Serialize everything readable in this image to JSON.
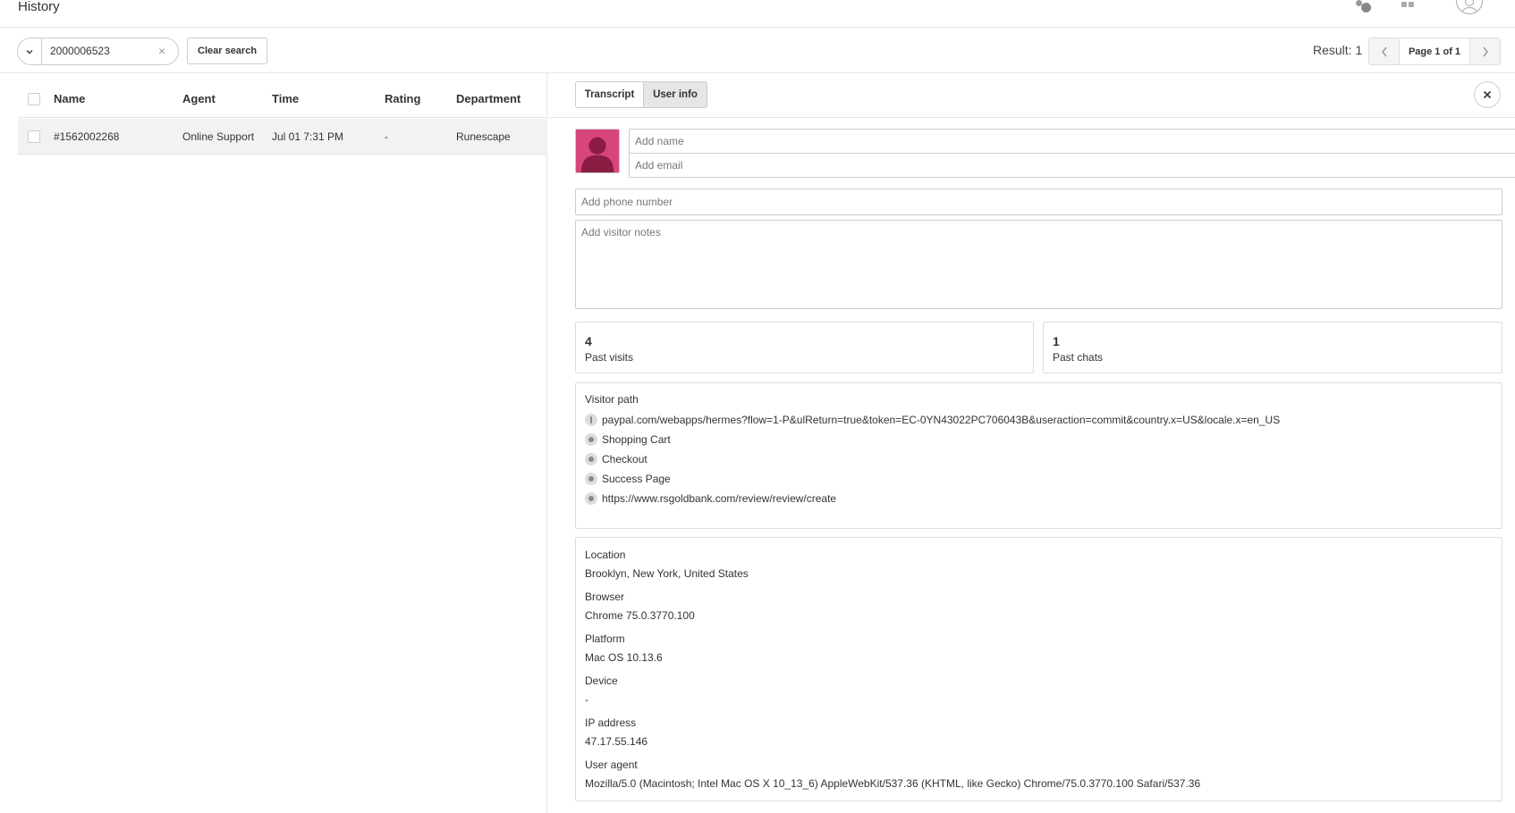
{
  "header": {
    "title": "History",
    "icons": [
      "status-dots-icon",
      "apps-grid-icon",
      "user-avatar-icon"
    ]
  },
  "search": {
    "value": "2000006523",
    "clear_label": "Clear search"
  },
  "results": {
    "count_label": "Result: 1",
    "page_label": "Page 1 of 1"
  },
  "table": {
    "columns": [
      "Name",
      "Agent",
      "Time",
      "Rating",
      "Department"
    ],
    "rows": [
      {
        "name": "#1562002268",
        "agent": "Online Support",
        "time": "Jul 01 7:31 PM",
        "rating": "-",
        "department": "Runescape"
      }
    ]
  },
  "detail": {
    "tabs": [
      "Transcript",
      "User info"
    ],
    "active_tab": "User info",
    "placeholders": {
      "name": "Add name",
      "email": "Add email",
      "phone": "Add phone number",
      "notes": "Add visitor notes"
    },
    "stats": {
      "visits_value": "4",
      "visits_label": "Past visits",
      "chats_value": "1",
      "chats_label": "Past chats"
    },
    "visitor_path": {
      "title": "Visitor path",
      "items": [
        "paypal.com/webapps/hermes?flow=1-P&ulReturn=true&token=EC-0YN43022PC706043B&useraction=commit&country.x=US&locale.x=en_US",
        "Shopping Cart",
        "Checkout",
        "Success Page",
        "https://www.rsgoldbank.com/review/review/create"
      ]
    },
    "info": {
      "location_label": "Location",
      "location": "Brooklyn, New York, United States",
      "browser_label": "Browser",
      "browser": "Chrome 75.0.3770.100",
      "platform_label": "Platform",
      "platform": "Mac OS 10.13.6",
      "device_label": "Device",
      "device": "-",
      "ip_label": "IP address",
      "ip": "47.17.55.146",
      "ua_label": "User agent",
      "user_agent": "Mozilla/5.0 (Macintosh; Intel Mac OS X 10_13_6) AppleWebKit/537.36 (KHTML, like Gecko) Chrome/75.0.3770.100 Safari/537.36"
    }
  },
  "colors": {
    "avatar_background": "#d8457d",
    "selected_row": "#f2f2f2",
    "active_tab": "#e6e6e6",
    "border": "#cccccc"
  }
}
